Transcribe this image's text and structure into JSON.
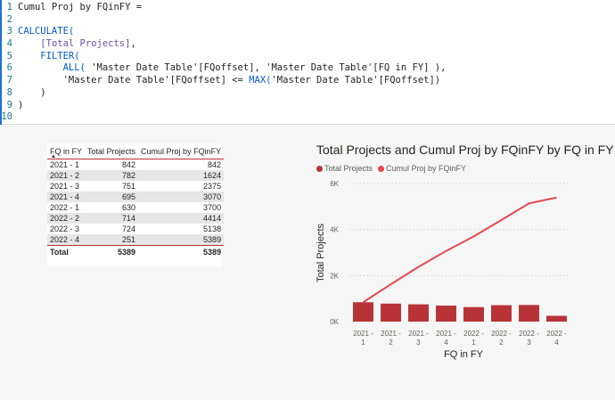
{
  "editor": {
    "lines": [
      {
        "n": "1",
        "tokens": [
          {
            "t": "Cumul Proj by FQinFY =",
            "c": "plain"
          }
        ]
      },
      {
        "n": "2",
        "tokens": []
      },
      {
        "n": "3",
        "tokens": [
          {
            "t": "CALCULATE(",
            "c": "kw"
          }
        ]
      },
      {
        "n": "4",
        "tokens": [
          {
            "t": "    ",
            "c": "plain"
          },
          {
            "t": "[Total Projects]",
            "c": "ref"
          },
          {
            "t": ",",
            "c": "plain"
          }
        ]
      },
      {
        "n": "5",
        "tokens": [
          {
            "t": "    ",
            "c": "plain"
          },
          {
            "t": "FILTER(",
            "c": "kw"
          }
        ]
      },
      {
        "n": "6",
        "tokens": [
          {
            "t": "        ",
            "c": "plain"
          },
          {
            "t": "ALL(",
            "c": "kw"
          },
          {
            "t": " 'Master Date Table'[FQoffset], 'Master Date Table'[FQ in FY] ),",
            "c": "plain"
          }
        ]
      },
      {
        "n": "7",
        "tokens": [
          {
            "t": "        'Master Date Table'[FQoffset] <= ",
            "c": "plain"
          },
          {
            "t": "MAX(",
            "c": "kw"
          },
          {
            "t": "'Master Date Table'[FQoffset])",
            "c": "plain"
          }
        ]
      },
      {
        "n": "8",
        "tokens": [
          {
            "t": "    )",
            "c": "plain"
          }
        ]
      },
      {
        "n": "9",
        "tokens": [
          {
            "t": ")",
            "c": "plain"
          }
        ]
      },
      {
        "n": "10",
        "tokens": []
      }
    ]
  },
  "table": {
    "headers": [
      "FQ in FY",
      "Total Projects",
      "Cumul Proj by FQinFY"
    ],
    "rows": [
      [
        "2021 - 1",
        "842",
        "842"
      ],
      [
        "2021 - 2",
        "782",
        "1624"
      ],
      [
        "2021 - 3",
        "751",
        "2375"
      ],
      [
        "2021 - 4",
        "695",
        "3070"
      ],
      [
        "2022 - 1",
        "630",
        "3700"
      ],
      [
        "2022 - 2",
        "714",
        "4414"
      ],
      [
        "2022 - 3",
        "724",
        "5138"
      ],
      [
        "2022 - 4",
        "251",
        "5389"
      ]
    ],
    "total": [
      "Total",
      "5389",
      "5389"
    ]
  },
  "chart": {
    "title": "Total Projects and Cumul Proj by FQinFY by FQ in FY",
    "legend": [
      "Total Projects",
      "Cumul Proj by FQinFY"
    ],
    "bar_color": "#b83338",
    "line_color": "#e5474d"
  },
  "chart_data": {
    "type": "bar",
    "title": "Total Projects and Cumul Proj by FQinFY by FQ in FY",
    "categories_top": [
      "2021 -",
      "2021 -",
      "2021 -",
      "2021 -",
      "2022 -",
      "2022 -",
      "2022 -",
      "2022 -"
    ],
    "categories_bottom": [
      "1",
      "2",
      "3",
      "4",
      "1",
      "2",
      "3",
      "4"
    ],
    "xlabel": "FQ in FY",
    "ylabel": "Total Projects",
    "ylim": [
      0,
      6000
    ],
    "yticks": [
      0,
      2000,
      4000,
      6000
    ],
    "ytick_labels": [
      "0K",
      "2K",
      "4K",
      "6K"
    ],
    "grid": true,
    "legend_position": "top-left",
    "series": [
      {
        "name": "Total Projects",
        "kind": "bar",
        "values": [
          842,
          782,
          751,
          695,
          630,
          714,
          724,
          251
        ]
      },
      {
        "name": "Cumul Proj by FQinFY",
        "kind": "line",
        "values": [
          842,
          1624,
          2375,
          3070,
          3700,
          4414,
          5138,
          5389
        ]
      }
    ]
  }
}
